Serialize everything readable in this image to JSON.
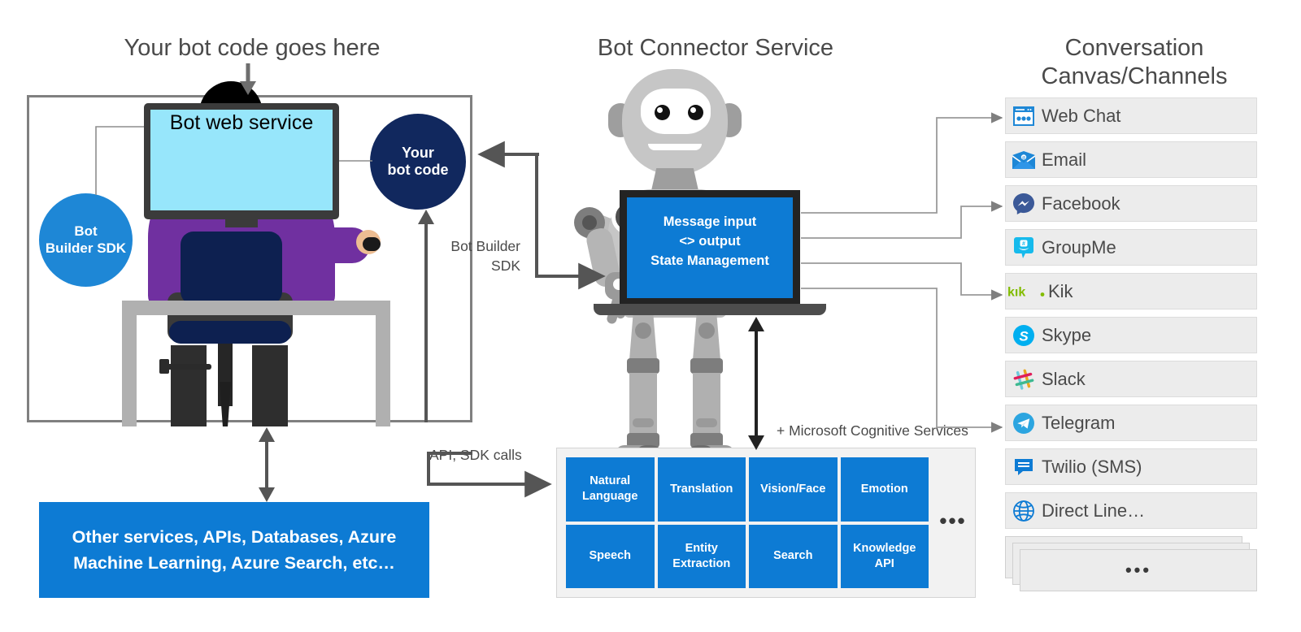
{
  "headings": {
    "left": "Your bot code goes here",
    "center": "Bot Connector Service",
    "right": "Conversation\nCanvas/Channels"
  },
  "left_panel": {
    "monitor_label": "Bot web service",
    "sdk_circle": "Bot\nBuilder SDK",
    "botcode_circle": "Your\nbot code"
  },
  "connector": {
    "laptop_text": "Message input\n<> output\nState Management"
  },
  "arrow_labels": {
    "bot_builder_sdk": "Bot Builder\nSDK",
    "api_sdk_calls": "API, SDK calls"
  },
  "other_services": {
    "text": "Other services, APIs, Databases, Azure\nMachine Learning, Azure Search, etc…"
  },
  "cognitive": {
    "caption": "+ Microsoft Cognitive Services",
    "overflow": "•••",
    "cells": [
      "Natural\nLanguage",
      "Translation",
      "Vision/Face",
      "Emotion",
      "Speech",
      "Entity\nExtraction",
      "Search",
      "Knowledge\nAPI"
    ]
  },
  "channels": {
    "items": [
      {
        "label": "Web Chat",
        "icon": "web-chat-icon"
      },
      {
        "label": "Email",
        "icon": "email-icon"
      },
      {
        "label": "Facebook",
        "icon": "facebook-messenger-icon"
      },
      {
        "label": "GroupMe",
        "icon": "groupme-icon"
      },
      {
        "label": "Kik",
        "icon": "kik-icon"
      },
      {
        "label": "Skype",
        "icon": "skype-icon"
      },
      {
        "label": "Slack",
        "icon": "slack-icon"
      },
      {
        "label": "Telegram",
        "icon": "telegram-icon"
      },
      {
        "label": "Twilio (SMS)",
        "icon": "twilio-sms-icon"
      },
      {
        "label": "Direct Line…",
        "icon": "direct-line-globe-icon"
      }
    ],
    "more_label": "•••"
  },
  "colors": {
    "azure_blue": "#0d7bd4",
    "sdk_blue": "#1e87d6",
    "navy": "#11285e",
    "purple": "#7030a0",
    "screen_cyan": "#97e6fb",
    "gray_outline": "#808080",
    "channel_bg": "#ececec",
    "text_gray": "#4a4a4a"
  }
}
